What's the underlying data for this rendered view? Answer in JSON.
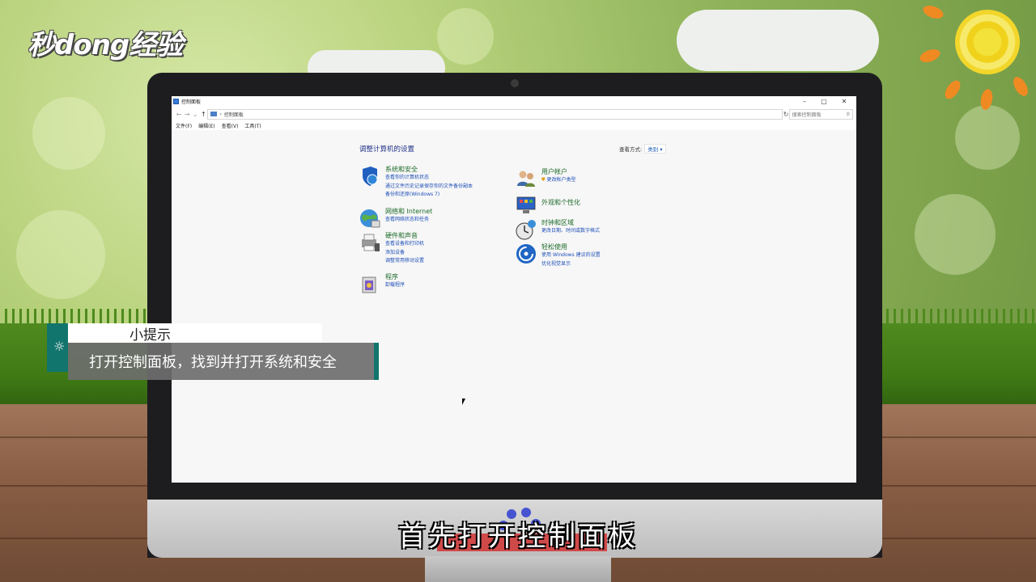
{
  "logo": {
    "text": "秒dong经验"
  },
  "window": {
    "title": "控制面板",
    "controls": {
      "minimize": "–",
      "maximize": "▢",
      "close": "✕"
    },
    "breadcrumb": "控制面板",
    "search_placeholder": "搜索控制面板",
    "menu": [
      "文件(F)",
      "编辑(E)",
      "查看(V)",
      "工具(T)"
    ]
  },
  "content": {
    "heading": "调整计算机的设置",
    "view_by_label": "查看方式:",
    "view_by_value": "类别 ▾",
    "categories": [
      {
        "title": "系统和安全",
        "links": [
          "查看你的计算机状态",
          "通过文件历史记录保存你的文件备份副本",
          "备份和还原(Windows 7)"
        ],
        "icon": "shield-icon"
      },
      {
        "title": "网络和 Internet",
        "links": [
          "查看网络状态和任务"
        ],
        "icon": "globe-icon"
      },
      {
        "title": "硬件和声音",
        "links": [
          "查看设备和打印机",
          "添加设备",
          "调整常用移动设置"
        ],
        "icon": "printer-icon"
      },
      {
        "title": "程序",
        "links": [
          "卸载程序"
        ],
        "icon": "programs-icon"
      },
      {
        "title": "用户帐户",
        "links": [
          "更改帐户类型"
        ],
        "icon": "users-icon"
      },
      {
        "title": "外观和个性化",
        "links": [],
        "icon": "appearance-icon"
      },
      {
        "title": "时钟和区域",
        "links": [
          "更改日期、时间或数字格式"
        ],
        "icon": "clock-icon"
      },
      {
        "title": "轻松使用",
        "links": [
          "使用 Windows 建议的设置",
          "优化视觉显示"
        ],
        "icon": "ease-of-access-icon"
      }
    ]
  },
  "tip": {
    "heading": "小提示",
    "body": "打开控制面板，找到并打开系统和安全"
  },
  "subtitle": "首先打开控制面板"
}
